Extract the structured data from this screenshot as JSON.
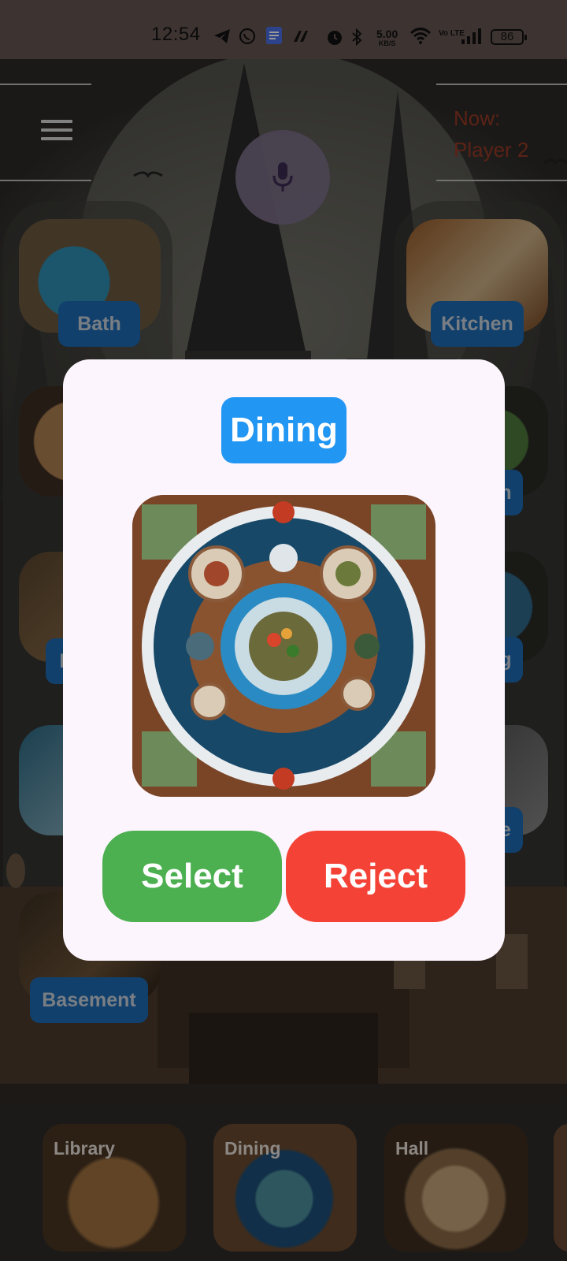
{
  "status_bar": {
    "time": "12:54",
    "net_speed": "5.00",
    "net_unit": "KB/S",
    "volte": "Vo LTE",
    "battery": "86",
    "icons": [
      "telegram-icon",
      "whatsapp-icon",
      "docs-icon",
      "app-icon",
      "alarm-icon",
      "bluetooth-icon",
      "wifi-icon",
      "signal-icon"
    ]
  },
  "header": {
    "menu_icon": "hamburger-menu-icon",
    "mic_icon": "microphone-icon",
    "turn_line1": "Now:",
    "turn_line2": "Player 2"
  },
  "rooms": {
    "bath": "Bath",
    "kitchen": "Kitchen",
    "basement": "Basement",
    "left_partial_1": "L",
    "right_partial_1": "n",
    "right_partial_2": "g",
    "right_partial_3": "e"
  },
  "bottom_strip": [
    {
      "label": "Library"
    },
    {
      "label": "Dining"
    },
    {
      "label": "Hall"
    }
  ],
  "dialog": {
    "title": "Dining",
    "image_alt": "dining-room-table-top-view",
    "select_label": "Select",
    "reject_label": "Reject"
  },
  "colors": {
    "title_bg": "#2196f3",
    "select_bg": "#4caf50",
    "reject_bg": "#f44336",
    "tag_bg": "#1e6cb5",
    "turn_text": "#9a3a26",
    "mic_bg": "#7c6f87",
    "dialog_bg": "#fcf5fd"
  }
}
